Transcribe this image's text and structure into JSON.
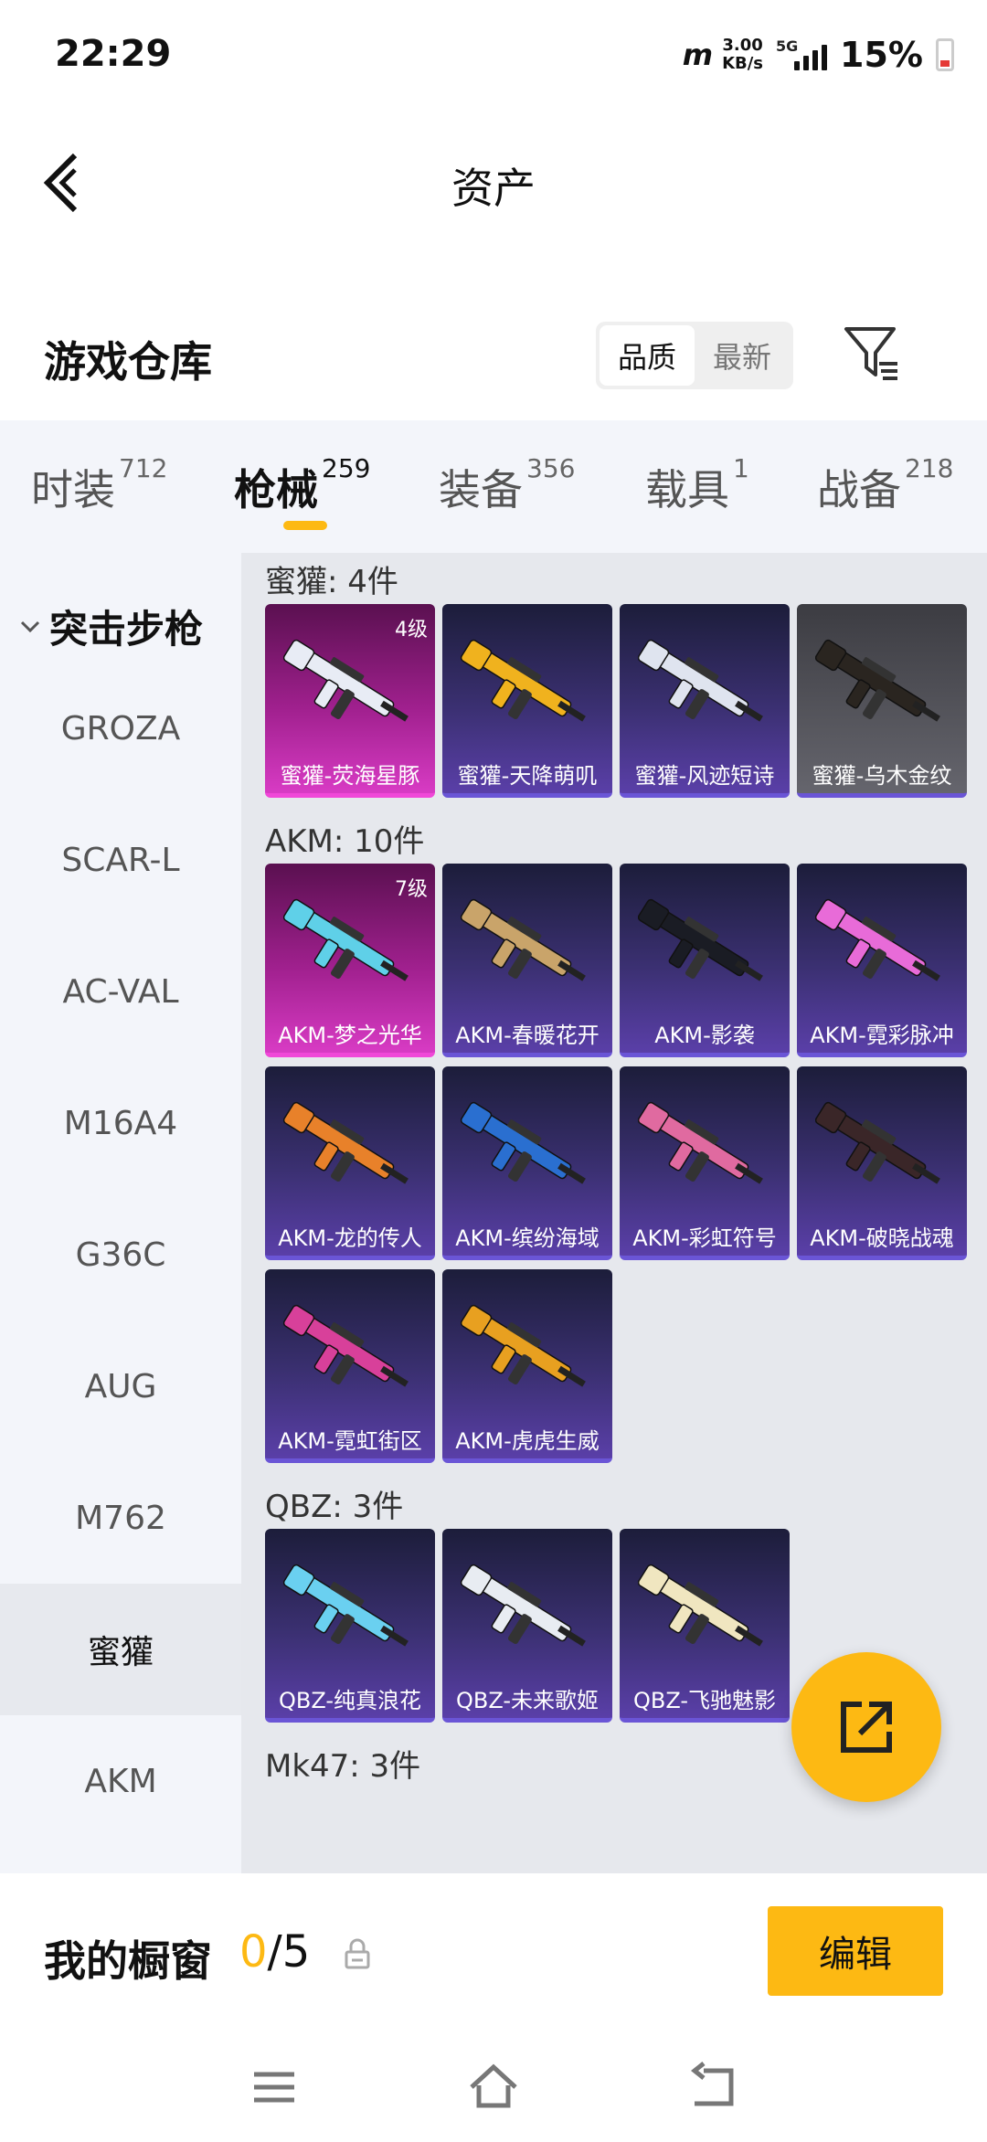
{
  "status_bar": {
    "time": "22:29",
    "carrier_logo": "m",
    "speed_value": "3.00",
    "speed_unit": "KB/s",
    "network": "5G",
    "battery": "15%"
  },
  "header": {
    "title": "资产"
  },
  "warehouse": {
    "title": "游戏仓库",
    "sort_options": [
      "品质",
      "最新"
    ],
    "active_sort": "品质"
  },
  "tabs": [
    {
      "label": "时装",
      "count": "712"
    },
    {
      "label": "枪械",
      "count": "259"
    },
    {
      "label": "装备",
      "count": "356"
    },
    {
      "label": "载具",
      "count": "1"
    },
    {
      "label": "战备",
      "count": "218"
    }
  ],
  "active_tab": "枪械",
  "sidebar": {
    "category": "突击步枪",
    "items": [
      "GROZA",
      "SCAR-L",
      "AC-VAL",
      "M16A4",
      "G36C",
      "AUG",
      "M762",
      "蜜獾",
      "AKM"
    ],
    "active_item": "蜜獾"
  },
  "groups": [
    {
      "title": "蜜獾: 4件",
      "items": [
        {
          "name": "蜜獾-荧海星豚",
          "level": "4级",
          "tier": "pink",
          "gun_color": "#e8ecf5"
        },
        {
          "name": "蜜獾-天降萌叽",
          "level": "",
          "tier": "purple",
          "gun_color": "#f0b21e"
        },
        {
          "name": "蜜獾-风迹短诗",
          "level": "",
          "tier": "purple",
          "gun_color": "#dfe4ef"
        },
        {
          "name": "蜜獾-乌木金纹",
          "level": "",
          "tier": "gray",
          "gun_color": "#2a2520"
        }
      ]
    },
    {
      "title": "AKM: 10件",
      "items": [
        {
          "name": "AKM-梦之光华",
          "level": "7级",
          "tier": "pink",
          "gun_color": "#5fd0e8"
        },
        {
          "name": "AKM-春暖花开",
          "level": "",
          "tier": "purple",
          "gun_color": "#c9a46a"
        },
        {
          "name": "AKM-影袭",
          "level": "",
          "tier": "purple",
          "gun_color": "#1a1c24"
        },
        {
          "name": "AKM-霓彩脉冲",
          "level": "",
          "tier": "purple",
          "gun_color": "#e86bd8"
        },
        {
          "name": "AKM-龙的传人",
          "level": "",
          "tier": "purple",
          "gun_color": "#e8812a"
        },
        {
          "name": "AKM-缤纷海域",
          "level": "",
          "tier": "purple",
          "gun_color": "#2a6fd0"
        },
        {
          "name": "AKM-彩虹符号",
          "level": "",
          "tier": "purple",
          "gun_color": "#e06aa0"
        },
        {
          "name": "AKM-破晓战魂",
          "level": "",
          "tier": "purple",
          "gun_color": "#3a2628"
        },
        {
          "name": "AKM-霓虹街区",
          "level": "",
          "tier": "purple",
          "gun_color": "#d8409a"
        },
        {
          "name": "AKM-虎虎生威",
          "level": "",
          "tier": "purple",
          "gun_color": "#e8a020"
        }
      ]
    },
    {
      "title": "QBZ: 3件",
      "items": [
        {
          "name": "QBZ-纯真浪花",
          "level": "",
          "tier": "purple",
          "gun_color": "#6ad0f0"
        },
        {
          "name": "QBZ-未来歌姬",
          "level": "",
          "tier": "purple",
          "gun_color": "#e8ecf2"
        },
        {
          "name": "QBZ-飞驰魅影",
          "level": "",
          "tier": "purple",
          "gun_color": "#f0e6c0"
        }
      ]
    },
    {
      "title": "Mk47: 3件",
      "items": []
    }
  ],
  "showcase": {
    "label": "我的橱窗",
    "current": "0",
    "max": "/5",
    "edit_label": "编辑"
  },
  "icons": {
    "back": "back-arrow-icon",
    "filter": "filter-icon",
    "share": "share-icon",
    "lock": "lock-icon",
    "nav_menu": "menu-icon",
    "nav_home": "home-icon",
    "nav_back": "back-icon"
  },
  "colors": {
    "accent": "#fdb913",
    "pink_tier": "#d83bc4",
    "purple_tier": "#5a3fa8"
  }
}
